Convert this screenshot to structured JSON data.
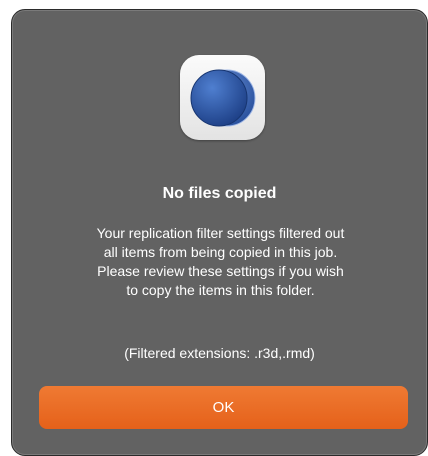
{
  "dialog": {
    "icon": "replication-app-icon",
    "title": "No files copied",
    "message": "Your replication filter settings filtered out\nall items from being copied in this job.\nPlease review these settings if you wish\nto copy the items in this folder.",
    "extensions": "(Filtered extensions: .r3d,.rmd)",
    "ok_label": "OK"
  },
  "colors": {
    "background": "#626262",
    "accent": "#e86a22",
    "icon_blue": "#2f5fb0"
  }
}
